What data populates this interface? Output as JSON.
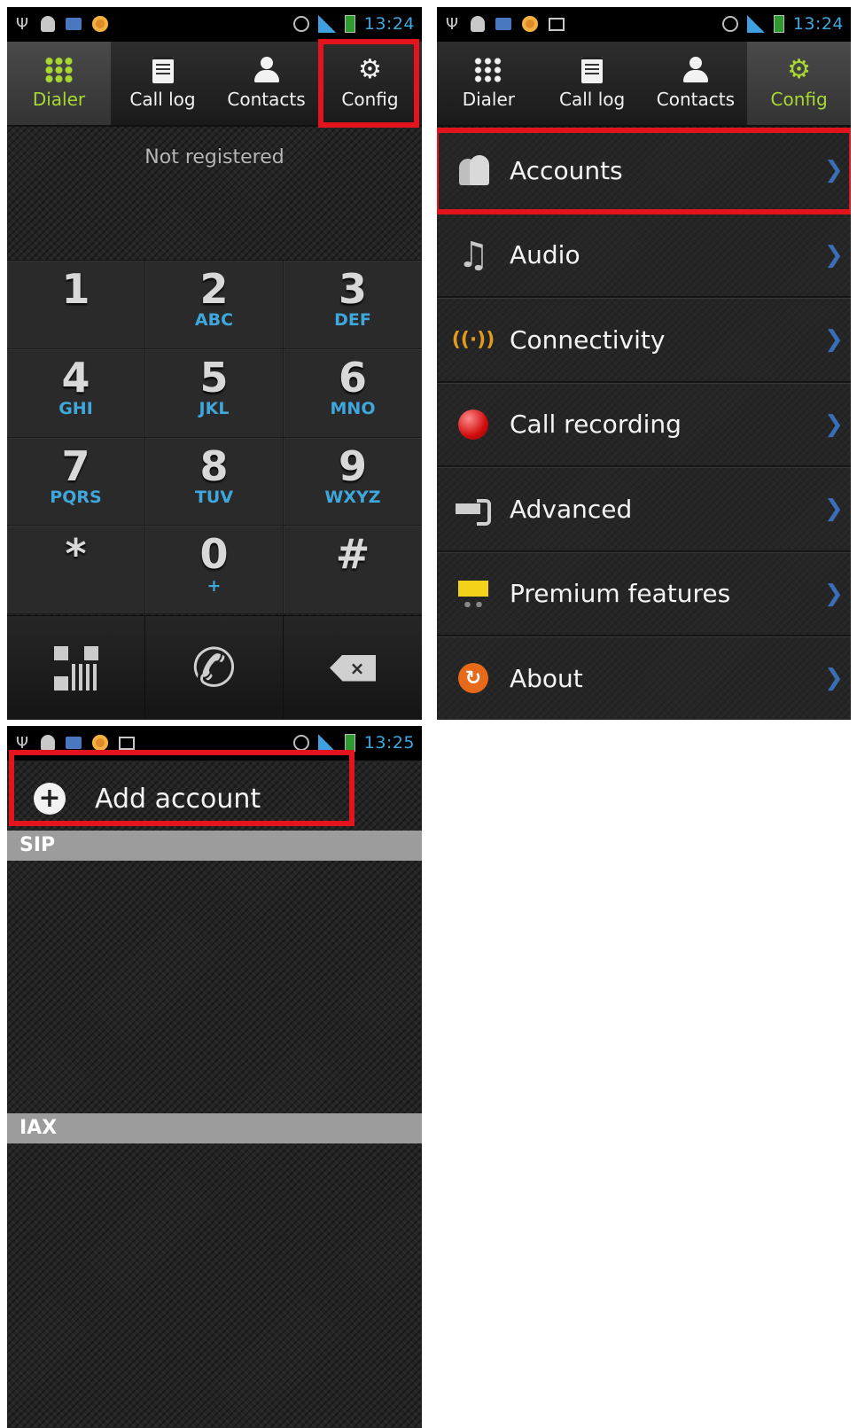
{
  "status_bars": [
    {
      "time": "13:24"
    },
    {
      "time": "13:24"
    },
    {
      "time": "13:25"
    }
  ],
  "dialer_screen": {
    "tabs": [
      {
        "label": "Dialer"
      },
      {
        "label": "Call log"
      },
      {
        "label": "Contacts"
      },
      {
        "label": "Config"
      }
    ],
    "active_tab": "Dialer",
    "registration_status": "Not registered",
    "keys": [
      {
        "digit": "1",
        "letters": ""
      },
      {
        "digit": "2",
        "letters": "ABC"
      },
      {
        "digit": "3",
        "letters": "DEF"
      },
      {
        "digit": "4",
        "letters": "GHI"
      },
      {
        "digit": "5",
        "letters": "JKL"
      },
      {
        "digit": "6",
        "letters": "MNO"
      },
      {
        "digit": "7",
        "letters": "PQRS"
      },
      {
        "digit": "8",
        "letters": "TUV"
      },
      {
        "digit": "9",
        "letters": "WXYZ"
      },
      {
        "digit": "*",
        "letters": ""
      },
      {
        "digit": "0",
        "letters": "+"
      },
      {
        "digit": "#",
        "letters": ""
      }
    ],
    "actions": [
      "qr-code-icon",
      "call-icon",
      "backspace-icon"
    ]
  },
  "config_screen": {
    "tabs": [
      {
        "label": "Dialer"
      },
      {
        "label": "Call log"
      },
      {
        "label": "Contacts"
      },
      {
        "label": "Config"
      }
    ],
    "active_tab": "Config",
    "menu_items": [
      {
        "label": "Accounts",
        "icon": "accounts-icon"
      },
      {
        "label": "Audio",
        "icon": "music-note-icon"
      },
      {
        "label": "Connectivity",
        "icon": "antenna-icon"
      },
      {
        "label": "Call recording",
        "icon": "record-icon"
      },
      {
        "label": "Advanced",
        "icon": "wrench-icon"
      },
      {
        "label": "Premium features",
        "icon": "cart-icon"
      },
      {
        "label": "About",
        "icon": "about-icon"
      }
    ]
  },
  "accounts_screen": {
    "add_account_label": "Add account",
    "sections": [
      {
        "title": "SIP"
      },
      {
        "title": "IAX"
      }
    ]
  },
  "colors": {
    "highlight": "#e3141e",
    "active_tab": "#a8d832",
    "key_letters": "#3ea7dc",
    "time": "#3da9e0",
    "chevron": "#3a6fb8",
    "section_header": "#9c9c9c"
  }
}
